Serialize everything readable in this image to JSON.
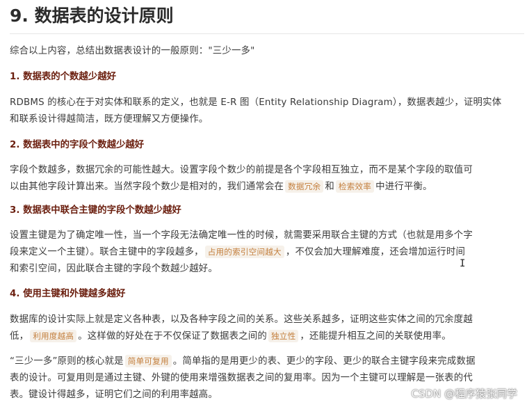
{
  "title": "9. 数据表的设计原则",
  "intro": "综合以上内容，总结出数据表设计的一般原则：\"三少一多\"",
  "sections": [
    {
      "heading": "1. 数据表的个数越少越好",
      "l1": "RDBMS 的核心在于对实体和联系的定义，也就是 E-R 图（Entity Relationship Diagram），数据表越少，证明实体",
      "l2": "和联系设计得越简洁，既方便理解又方便操作。"
    },
    {
      "heading": "2. 数据表中的字段个数越少越好",
      "l1": "字段个数越多，数据冗余的可能性越大。设置字段个数少的前提是各个字段相互独立，而不是某个字段的取值可",
      "l2a": "以由其他字段计算出来。当然字段个数少是相对的，我们通常会在",
      "hl1": "数据冗余",
      "l2b": "和",
      "hl2": "检索效率",
      "l2c": "中进行平衡。"
    },
    {
      "heading": "3. 数据表中联合主键的字段个数越少越好",
      "l1": "设置主键是为了确定唯一性，当一个字段无法确定唯一性的时候，就需要采用联合主键的方式（也就是用多个字",
      "l2a": "段来定义一个主键）。联合主键中的字段越多，",
      "hl1": "占用的索引空间越大",
      "l2b": "，不仅会加大理解难度，还会增加运行时间",
      "l3": "和索引空间，因此联合主键的字段个数越少越好。"
    },
    {
      "heading": "4. 使用主键和外键越多越好",
      "l1": "数据库的设计实际上就是定义各种表，以及各种字段之间的关系。这些关系越多，证明这些实体之间的冗余度越",
      "l2a": "低，",
      "hl1": "利用度越高",
      "l2b": "。这样做的好处在于不仅保证了数据表之间的",
      "hl2": "独立性",
      "l2c": "，还能提升相互之间的关联使用率。"
    }
  ],
  "closing": {
    "l1a": "“三少一多”原则的核心就是",
    "hl1": "简单可复用",
    "l1b": "。简单指的是用更少的表、更少的字段、更少的联合主键字段来完成数据",
    "l2": "表的设计。可复用则是通过主键、外键的使用来增强数据表之间的复用率。因为一个主键可以理解是一张表的代",
    "l3": "表。键设计得越多，证明它们之间的利用率越高。"
  },
  "cursor_glyph": "I",
  "watermark": "CSDN @程序猿张同学"
}
